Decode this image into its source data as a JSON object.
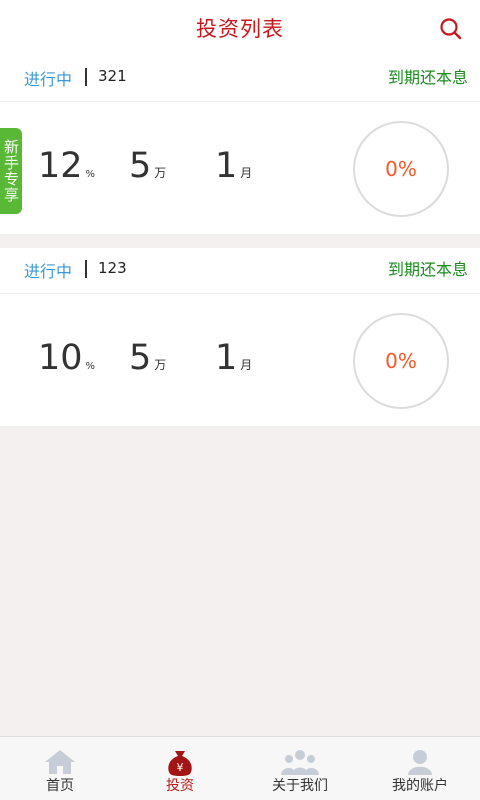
{
  "header": {
    "title": "投资列表"
  },
  "products": [
    {
      "status": "进行中",
      "id": "321",
      "repayment": "到期还本息",
      "rate": "12",
      "rate_unit": "%",
      "amount": "5",
      "amount_unit": "万",
      "term": "1",
      "term_unit": "月",
      "progress": "0%",
      "badge": "新手专享"
    },
    {
      "status": "进行中",
      "id": "123",
      "repayment": "到期还本息",
      "rate": "10",
      "rate_unit": "%",
      "amount": "5",
      "amount_unit": "万",
      "term": "1",
      "term_unit": "月",
      "progress": "0%"
    }
  ],
  "tabs": [
    {
      "label": "首页",
      "icon": "home-icon"
    },
    {
      "label": "投资",
      "icon": "money-bag-icon"
    },
    {
      "label": "关于我们",
      "icon": "people-icon"
    },
    {
      "label": "我的账户",
      "icon": "user-icon"
    }
  ],
  "colors": {
    "accent": "#c8161d",
    "status": "#3a9ad9",
    "repay": "#1c8a1c",
    "progress": "#f05a28",
    "badge": "#5ab837"
  }
}
